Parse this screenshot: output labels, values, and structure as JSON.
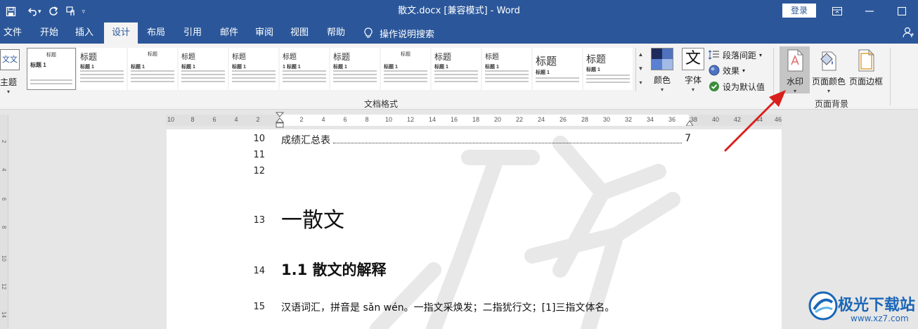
{
  "window": {
    "title": "散文.docx [兼容模式] - Word",
    "login_label": "登录"
  },
  "tabs": [
    {
      "label": "文件"
    },
    {
      "label": "开始"
    },
    {
      "label": "插入"
    },
    {
      "label": "设计",
      "active": true
    },
    {
      "label": "布局"
    },
    {
      "label": "引用"
    },
    {
      "label": "邮件"
    },
    {
      "label": "审阅"
    },
    {
      "label": "视图"
    },
    {
      "label": "帮助"
    }
  ],
  "search": {
    "label": "操作说明搜索"
  },
  "ribbon": {
    "themes_label": "主题",
    "themes_icon_text": "文文",
    "gallery": [
      {
        "title": "标题",
        "sub": "标题 1"
      },
      {
        "title": "标题",
        "sub": "标题 1"
      },
      {
        "title": "标题",
        "sub": "标题 1"
      },
      {
        "title": "标题",
        "sub": "标题 1"
      },
      {
        "title": "标题",
        "sub": "标题 1"
      },
      {
        "title": "标题",
        "sub": "1 标题 1"
      },
      {
        "title": "标题",
        "sub": "标题 1"
      },
      {
        "title": "标题",
        "sub": "标题 1"
      },
      {
        "title": "标题",
        "sub": "标题 1"
      },
      {
        "title": "标题",
        "sub": "标题 1"
      },
      {
        "title": "标题",
        "sub": "标题 1"
      },
      {
        "title": "标题",
        "sub": "标题 1"
      }
    ],
    "document_formatting_label": "文档格式",
    "colors_label": "颜色",
    "fonts_label": "字体",
    "fonts_icon_text": "文",
    "paragraph_spacing_label": "段落间距",
    "effects_label": "效果",
    "set_default_label": "设为默认值",
    "watermark_label": "水印",
    "page_color_label": "页面颜色",
    "page_borders_label": "页面边框",
    "page_background_label": "页面背景"
  },
  "ruler": {
    "left_ticks": [
      "10",
      "8",
      "6",
      "4",
      "2"
    ],
    "right_ticks": [
      "2",
      "4",
      "6",
      "8",
      "10",
      "12",
      "14",
      "16",
      "18",
      "20",
      "22",
      "24",
      "26",
      "28",
      "30",
      "32",
      "34",
      "36",
      "38",
      "40",
      "42",
      "44",
      "46"
    ]
  },
  "vruler": {
    "ticks": [
      "2",
      "4",
      "6",
      "8",
      "10",
      "12",
      "14"
    ]
  },
  "document": {
    "lines": [
      {
        "no": "10",
        "text": "成绩汇总表",
        "page": "7"
      },
      {
        "no": "11"
      },
      {
        "no": "12"
      },
      {
        "no": "13",
        "text": "一散文"
      },
      {
        "no": "14",
        "text": "1.1 散文的解释"
      },
      {
        "no": "15",
        "text": "汉语词汇，拼音是 sǎn wén。一指文采焕发；二指犹行文；[1]三指文体名。"
      }
    ]
  },
  "site_logo": {
    "name": "极光下载站",
    "url": "www.xz7.com"
  },
  "colors": {
    "titlebar": "#2b579a",
    "ribbon": "#f3f3f3",
    "arrow": "#d9201c"
  }
}
